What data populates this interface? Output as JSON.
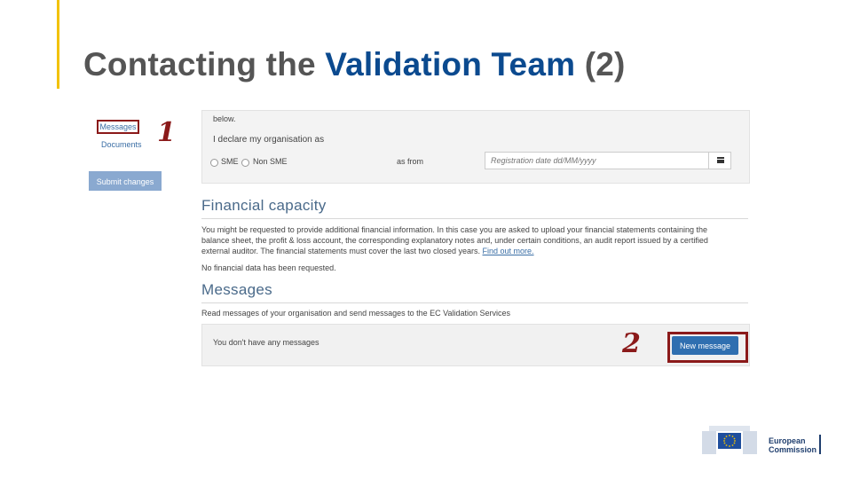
{
  "slide": {
    "title_part1": "Contacting the ",
    "title_highlight": "Validation Team",
    "title_part2": " (2)",
    "accent_color": "#f2c200",
    "highlight_color": "#0b4a8f"
  },
  "left_nav": {
    "messages_label": "Messages",
    "documents_label": "Documents",
    "submit_label": "Submit changes"
  },
  "annotations": {
    "step1": "1",
    "step2": "2",
    "color": "#8b1a1a"
  },
  "sme_section": {
    "below_text": "below.",
    "declare_label": "I declare my organisation as",
    "option_sme": "SME",
    "option_non_sme": "Non SME",
    "as_from_label": "as from",
    "date_placeholder": "Registration date dd/MM/yyyy",
    "calendar_icon": "calendar-icon"
  },
  "financial_capacity": {
    "heading": "Financial capacity",
    "paragraph": "You might be requested to provide additional financial information. In this case you are asked to upload your financial statements containing the balance sheet, the profit & loss account, the corresponding explanatory notes and, under certain conditions, an audit report issued by a certified external auditor. The financial statements must cover the last two closed years. ",
    "find_out_more": "Find out more.",
    "no_data": "No financial data has been requested."
  },
  "messages_section": {
    "heading": "Messages",
    "description": "Read messages of your organisation and send messages to the EC Validation Services",
    "empty_text": "You don't have any messages",
    "new_message_label": "New message"
  },
  "footer_logo": {
    "line1": "European",
    "line2": "Commission",
    "brand_color": "#1f3e6e"
  }
}
